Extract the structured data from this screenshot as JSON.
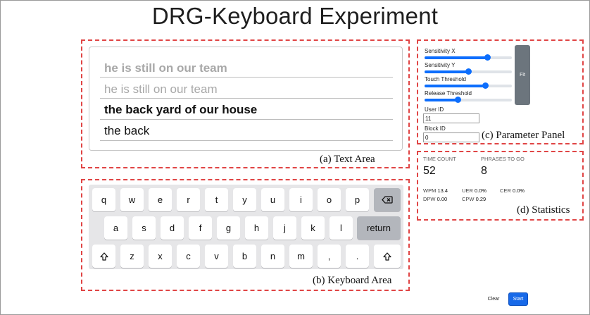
{
  "page": {
    "title": "DRG-Keyboard Experiment"
  },
  "text_area": {
    "caption": "(a) Text Area",
    "previous_phrase": "he is still on our team",
    "previous_phrase_ghost": "he is still on our team",
    "target_phrase": "the back yard of our house",
    "typed_text": "the back"
  },
  "keyboard": {
    "caption": "(b) Keyboard Area",
    "row1": [
      "q",
      "w",
      "e",
      "r",
      "t",
      "y",
      "u",
      "i",
      "o",
      "p"
    ],
    "row2": [
      "a",
      "s",
      "d",
      "f",
      "g",
      "h",
      "j",
      "k",
      "l"
    ],
    "row3": [
      "z",
      "x",
      "c",
      "v",
      "b",
      "n",
      "m",
      ",",
      "."
    ],
    "return_label": "return",
    "backspace_icon": "backspace-icon",
    "shift_icon": "shift-icon"
  },
  "parameter_panel": {
    "caption": "(c) Parameter Panel",
    "sliders": [
      {
        "label": "Sensitivity X",
        "value": 0.72
      },
      {
        "label": "Sensitivity Y",
        "value": 0.5
      },
      {
        "label": "Touch Threshold",
        "value": 0.69
      },
      {
        "label": "Release Threshold",
        "value": 0.38
      }
    ],
    "fit_label": "Fit",
    "user_id_label": "User ID",
    "user_id_value": "11",
    "block_id_label": "Block ID",
    "block_id_value": "0"
  },
  "statistics": {
    "caption": "(d) Statistics",
    "time_count_label": "TIME COUNT",
    "time_count_value": "52",
    "phrases_to_go_label": "PHRASES TO GO",
    "phrases_to_go_value": "8",
    "wpm_label": "WPM",
    "wpm_value": "13.4",
    "uer_label": "UER",
    "uer_value": "0.0%",
    "cer_label": "CER",
    "cer_value": "0.0%",
    "dpw_label": "DPW",
    "dpw_value": "0.00",
    "cpw_label": "CPW",
    "cpw_value": "0.29"
  },
  "controls": {
    "clear_label": "Clear",
    "start_label": "Start"
  },
  "colors": {
    "accent": "#0d6efd",
    "annotation": "#e04545",
    "fit_button": "#6c757d"
  }
}
